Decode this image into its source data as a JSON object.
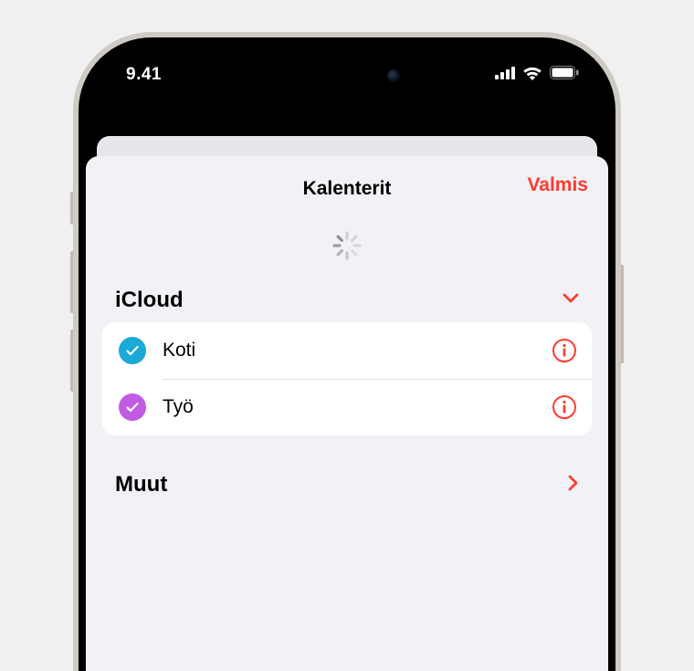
{
  "status": {
    "time": "9.41"
  },
  "sheet": {
    "title": "Kalenterit",
    "done": "Valmis"
  },
  "sections": {
    "icloud": {
      "title": "iCloud",
      "items": [
        {
          "label": "Koti",
          "color": "#1ba9d8"
        },
        {
          "label": "Työ",
          "color": "#c15be2"
        }
      ]
    },
    "other": {
      "title": "Muut"
    }
  },
  "colors": {
    "accent": "#ff3b30"
  }
}
